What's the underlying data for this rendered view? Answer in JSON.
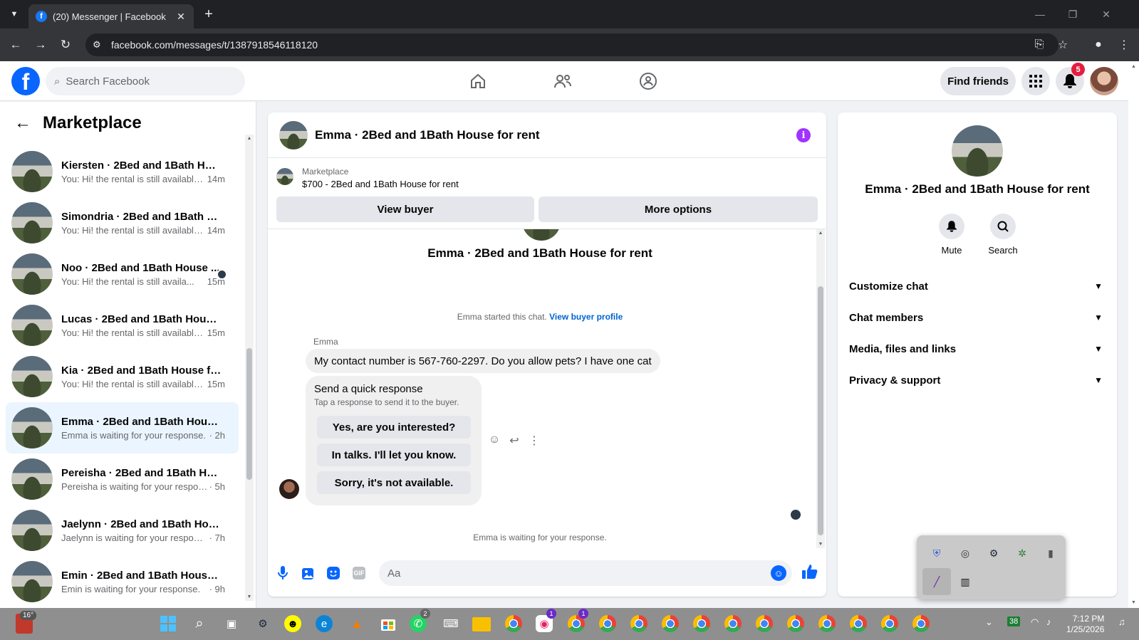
{
  "browser": {
    "tab_title": "(20) Messenger | Facebook",
    "tab_close": "✕",
    "new_tab": "+",
    "url": "facebook.com/messages/t/1387918546118120",
    "win_minimize": "—",
    "win_restore": "❐",
    "win_close": "✕"
  },
  "fb": {
    "search_placeholder": "Search Facebook",
    "find_friends": "Find friends",
    "notif_count": "5"
  },
  "sidebar": {
    "title": "Marketplace",
    "conversations": [
      {
        "name": "Kiersten · 2Bed and 1Bath Hous...",
        "msg": "You: Hi! the rental is still available...",
        "time": "14m"
      },
      {
        "name": "Simondria · 2Bed and 1Bath Ho...",
        "msg": "You: Hi! the rental is still available...",
        "time": "14m"
      },
      {
        "name": "Noo · 2Bed and 1Bath House ...",
        "msg": "You: Hi! the rental is still availa...",
        "time": "15m"
      },
      {
        "name": "Lucas · 2Bed and 1Bath House f...",
        "msg": "You: Hi! the rental is still available...",
        "time": "15m"
      },
      {
        "name": "Kia · 2Bed and 1Bath House for r...",
        "msg": "You: Hi! the rental is still available...",
        "time": "15m"
      },
      {
        "name": "Emma · 2Bed and 1Bath House f...",
        "msg": "Emma is waiting for your response.",
        "time": "· 2h"
      },
      {
        "name": "Pereisha · 2Bed and 1Bath Hous...",
        "msg": "Pereisha is waiting for your respon...",
        "time": "· 5h"
      },
      {
        "name": "Jaelynn · 2Bed and 1Bath House...",
        "msg": "Jaelynn is waiting for your response.",
        "time": "· 7h"
      },
      {
        "name": "Emin · 2Bed and 1Bath House fo...",
        "msg": "Emin is waiting for your response.",
        "time": "· 9h"
      }
    ]
  },
  "chat": {
    "title": "Emma · 2Bed and 1Bath House for rent",
    "marketplace_label": "Marketplace",
    "listing": "$700 - 2Bed and 1Bath House for rent",
    "view_buyer": "View buyer",
    "more_options": "More options",
    "intro_name": "Emma · 2Bed and 1Bath House for rent",
    "started_text": "Emma started this chat.",
    "view_buyer_profile": "View buyer profile",
    "sender": "Emma",
    "message": "My contact number is 567-760-2297. Do you allow pets? I have one cat",
    "quick_title": "Send a quick response",
    "quick_sub": "Tap a response to send it to the buyer.",
    "quick_responses": [
      "Yes, are you interested?",
      "In talks. I'll let you know.",
      "Sorry, it's not available."
    ],
    "waiting": "Emma is waiting for your response.",
    "composer_placeholder": "Aa",
    "gif_label": "GIF"
  },
  "info_panel": {
    "name": "Emma · 2Bed and 1Bath House for rent",
    "mute": "Mute",
    "search": "Search",
    "sections": [
      "Customize chat",
      "Chat members",
      "Media, files and links",
      "Privacy & support"
    ]
  },
  "taskbar": {
    "weather_temp": "16°",
    "whatsapp_badge": "2",
    "badge_1": "1",
    "badge_2": "1",
    "clock_time": "7:12 PM",
    "clock_date": "1/25/2026",
    "battery_label": "38"
  }
}
